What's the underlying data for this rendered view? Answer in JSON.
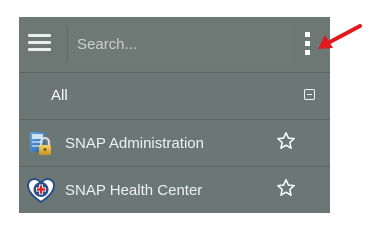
{
  "search": {
    "placeholder": "Search..."
  },
  "group": {
    "label": "All"
  },
  "items": [
    {
      "label": "SNAP Administration",
      "icon": "admin-lock-icon"
    },
    {
      "label": "SNAP Health Center",
      "icon": "health-cross-icon"
    }
  ],
  "colors": {
    "panel": "#6b7774",
    "text": "#eef2f1",
    "arrow": "#e0191e"
  }
}
